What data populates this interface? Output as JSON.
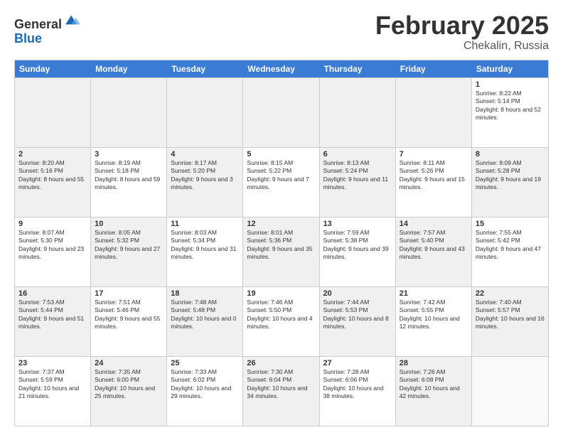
{
  "logo": {
    "general": "General",
    "blue": "Blue"
  },
  "header": {
    "month": "February 2025",
    "location": "Chekalin, Russia"
  },
  "dayHeaders": [
    "Sunday",
    "Monday",
    "Tuesday",
    "Wednesday",
    "Thursday",
    "Friday",
    "Saturday"
  ],
  "rows": [
    [
      {
        "day": "",
        "content": "",
        "shaded": true
      },
      {
        "day": "",
        "content": "",
        "shaded": true
      },
      {
        "day": "",
        "content": "",
        "shaded": true
      },
      {
        "day": "",
        "content": "",
        "shaded": true
      },
      {
        "day": "",
        "content": "",
        "shaded": true
      },
      {
        "day": "",
        "content": "",
        "shaded": true
      },
      {
        "day": "1",
        "content": "Sunrise: 8:22 AM\nSunset: 5:14 PM\nDaylight: 8 hours and 52 minutes.",
        "shaded": false
      }
    ],
    [
      {
        "day": "2",
        "content": "Sunrise: 8:20 AM\nSunset: 5:16 PM\nDaylight: 8 hours and 55 minutes.",
        "shaded": true
      },
      {
        "day": "3",
        "content": "Sunrise: 8:19 AM\nSunset: 5:18 PM\nDaylight: 8 hours and 59 minutes.",
        "shaded": false
      },
      {
        "day": "4",
        "content": "Sunrise: 8:17 AM\nSunset: 5:20 PM\nDaylight: 9 hours and 3 minutes.",
        "shaded": true
      },
      {
        "day": "5",
        "content": "Sunrise: 8:15 AM\nSunset: 5:22 PM\nDaylight: 9 hours and 7 minutes.",
        "shaded": false
      },
      {
        "day": "6",
        "content": "Sunrise: 8:13 AM\nSunset: 5:24 PM\nDaylight: 9 hours and 11 minutes.",
        "shaded": true
      },
      {
        "day": "7",
        "content": "Sunrise: 8:11 AM\nSunset: 5:26 PM\nDaylight: 9 hours and 15 minutes.",
        "shaded": false
      },
      {
        "day": "8",
        "content": "Sunrise: 8:09 AM\nSunset: 5:28 PM\nDaylight: 9 hours and 19 minutes.",
        "shaded": true
      }
    ],
    [
      {
        "day": "9",
        "content": "Sunrise: 8:07 AM\nSunset: 5:30 PM\nDaylight: 9 hours and 23 minutes.",
        "shaded": false
      },
      {
        "day": "10",
        "content": "Sunrise: 8:05 AM\nSunset: 5:32 PM\nDaylight: 9 hours and 27 minutes.",
        "shaded": true
      },
      {
        "day": "11",
        "content": "Sunrise: 8:03 AM\nSunset: 5:34 PM\nDaylight: 9 hours and 31 minutes.",
        "shaded": false
      },
      {
        "day": "12",
        "content": "Sunrise: 8:01 AM\nSunset: 5:36 PM\nDaylight: 9 hours and 35 minutes.",
        "shaded": true
      },
      {
        "day": "13",
        "content": "Sunrise: 7:59 AM\nSunset: 5:38 PM\nDaylight: 9 hours and 39 minutes.",
        "shaded": false
      },
      {
        "day": "14",
        "content": "Sunrise: 7:57 AM\nSunset: 5:40 PM\nDaylight: 9 hours and 43 minutes.",
        "shaded": true
      },
      {
        "day": "15",
        "content": "Sunrise: 7:55 AM\nSunset: 5:42 PM\nDaylight: 9 hours and 47 minutes.",
        "shaded": false
      }
    ],
    [
      {
        "day": "16",
        "content": "Sunrise: 7:53 AM\nSunset: 5:44 PM\nDaylight: 9 hours and 51 minutes.",
        "shaded": true
      },
      {
        "day": "17",
        "content": "Sunrise: 7:51 AM\nSunset: 5:46 PM\nDaylight: 9 hours and 55 minutes.",
        "shaded": false
      },
      {
        "day": "18",
        "content": "Sunrise: 7:48 AM\nSunset: 5:48 PM\nDaylight: 10 hours and 0 minutes.",
        "shaded": true
      },
      {
        "day": "19",
        "content": "Sunrise: 7:46 AM\nSunset: 5:50 PM\nDaylight: 10 hours and 4 minutes.",
        "shaded": false
      },
      {
        "day": "20",
        "content": "Sunrise: 7:44 AM\nSunset: 5:53 PM\nDaylight: 10 hours and 8 minutes.",
        "shaded": true
      },
      {
        "day": "21",
        "content": "Sunrise: 7:42 AM\nSunset: 5:55 PM\nDaylight: 10 hours and 12 minutes.",
        "shaded": false
      },
      {
        "day": "22",
        "content": "Sunrise: 7:40 AM\nSunset: 5:57 PM\nDaylight: 10 hours and 16 minutes.",
        "shaded": true
      }
    ],
    [
      {
        "day": "23",
        "content": "Sunrise: 7:37 AM\nSunset: 5:59 PM\nDaylight: 10 hours and 21 minutes.",
        "shaded": false
      },
      {
        "day": "24",
        "content": "Sunrise: 7:35 AM\nSunset: 6:00 PM\nDaylight: 10 hours and 25 minutes.",
        "shaded": true
      },
      {
        "day": "25",
        "content": "Sunrise: 7:33 AM\nSunset: 6:02 PM\nDaylight: 10 hours and 29 minutes.",
        "shaded": false
      },
      {
        "day": "26",
        "content": "Sunrise: 7:30 AM\nSunset: 6:04 PM\nDaylight: 10 hours and 34 minutes.",
        "shaded": true
      },
      {
        "day": "27",
        "content": "Sunrise: 7:28 AM\nSunset: 6:06 PM\nDaylight: 10 hours and 38 minutes.",
        "shaded": false
      },
      {
        "day": "28",
        "content": "Sunrise: 7:26 AM\nSunset: 6:08 PM\nDaylight: 10 hours and 42 minutes.",
        "shaded": true
      },
      {
        "day": "",
        "content": "",
        "shaded": false
      }
    ]
  ]
}
